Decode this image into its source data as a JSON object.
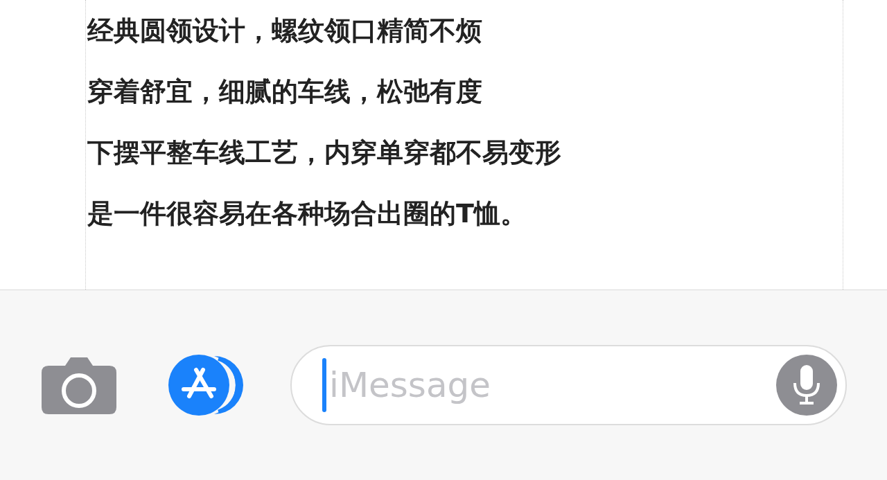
{
  "message_lines": [
    "经典圆领设计，螺纹领口精简不烦",
    "穿着舒宜，细腻的车线，松弛有度",
    "下摆平整车线工艺，内穿单穿都不易变形",
    "是一件很容易在各种场合出圈的T恤。"
  ],
  "input": {
    "placeholder": "iMessage",
    "focused": true
  }
}
